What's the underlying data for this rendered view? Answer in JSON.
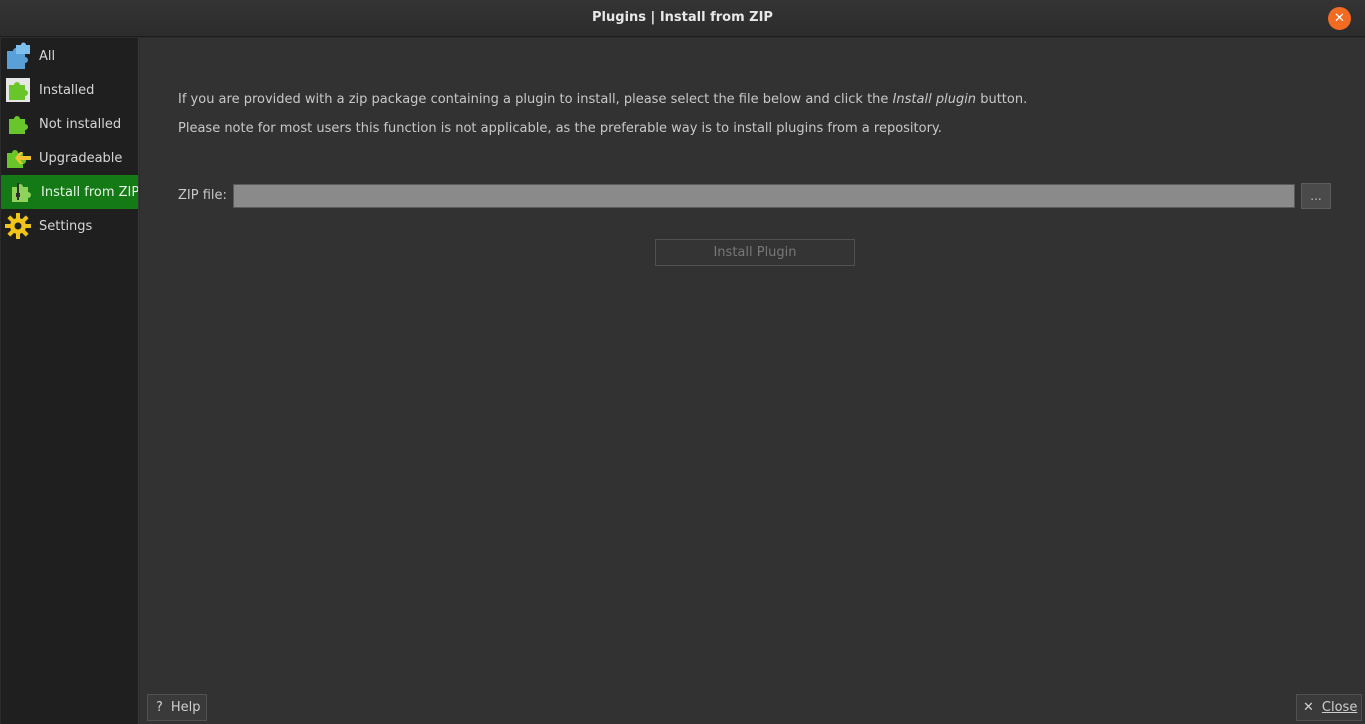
{
  "window": {
    "title": "Plugins | Install from ZIP"
  },
  "sidebar": {
    "items": [
      {
        "label": "All",
        "icon": "plugins-all-icon"
      },
      {
        "label": "Installed",
        "icon": "plugins-installed-icon"
      },
      {
        "label": "Not installed",
        "icon": "plugins-not-installed-icon"
      },
      {
        "label": "Upgradeable",
        "icon": "plugins-upgradeable-icon"
      },
      {
        "label": "Install from ZIP",
        "icon": "plugins-zip-icon",
        "active": true
      },
      {
        "label": "Settings",
        "icon": "gear-icon"
      }
    ]
  },
  "main": {
    "intro_line1_prefix": "If you are provided with a zip package containing a plugin to install, please select the file below and click the",
    "intro_line1_emphasis": "Install plugin",
    "intro_line1_suffix": "button.",
    "intro_line2": "Please note for most users this function is not applicable, as the preferable way is to install plugins from a repository.",
    "zip_label": "ZIP file:",
    "zip_value": "",
    "browse_label": "...",
    "install_label": "Install Plugin"
  },
  "footer": {
    "help_label": "Help",
    "close_label": "Close"
  },
  "colors": {
    "active_item": "#147a16",
    "close_icon": "#f26b22",
    "background": "#323232",
    "sidebar": "#1f1f1f"
  }
}
